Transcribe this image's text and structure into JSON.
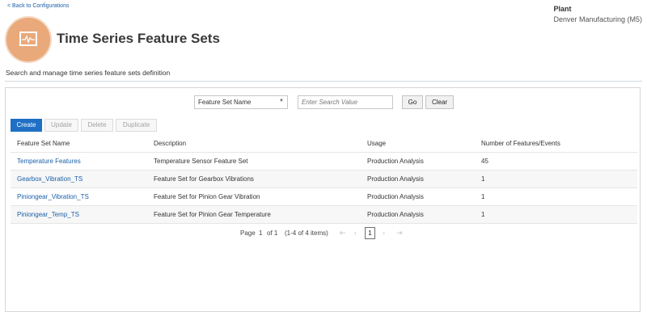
{
  "header": {
    "back_link": "< Back to Configurations",
    "title": "Time Series Feature Sets",
    "plant_label": "Plant",
    "plant_value": "Denver Manufacturing (M5)",
    "subheading": "Search and manage time series feature sets definition"
  },
  "search": {
    "field_selected": "Feature Set Name",
    "placeholder": "Enter Search Value",
    "go_label": "Go",
    "clear_label": "Clear"
  },
  "toolbar": {
    "create_label": "Create",
    "update_label": "Update",
    "delete_label": "Delete",
    "duplicate_label": "Duplicate"
  },
  "table": {
    "columns": [
      "Feature Set Name",
      "Description",
      "Usage",
      "Number of Features/Events"
    ],
    "rows": [
      [
        "Temperature Features",
        "Temperature Sensor Feature Set",
        "Production Analysis",
        "45"
      ],
      [
        "Gearbox_Vibration_TS",
        "Feature Set for Gearbox Vibrations",
        "Production Analysis",
        "1"
      ],
      [
        "Piniongear_Vibration_TS",
        "Feature Set for Pinion Gear Vibration",
        "Production Analysis",
        "1"
      ],
      [
        "Piniongear_Temp_TS",
        "Feature Set for Pinion Gear Temperature",
        "Production Analysis",
        "1"
      ]
    ]
  },
  "pagination": {
    "page_label": "Page",
    "current_page": "1",
    "of_label": "of 1",
    "range_label": "(1-4 of 4 items)",
    "page_button": "1"
  },
  "colors": {
    "accent": "#1f6fc5",
    "link": "#1a5fa8",
    "icon_bg": "#e9a97a"
  },
  "icons": {
    "hero": "chart-pulse-icon",
    "dropdown": "chevron-down-icon",
    "first": "first-page-icon",
    "prev": "previous-page-icon",
    "next": "next-page-icon",
    "last": "last-page-icon"
  }
}
